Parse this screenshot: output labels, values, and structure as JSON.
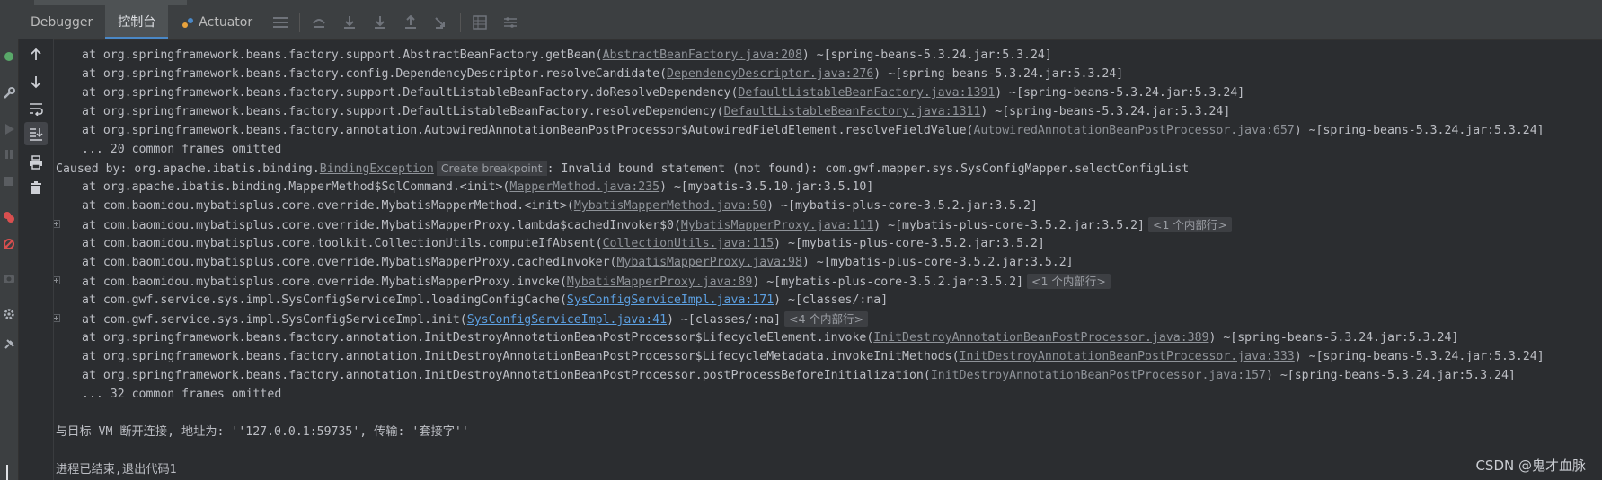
{
  "tabs": [
    {
      "label": "Debugger",
      "active": false
    },
    {
      "label": "控制台",
      "active": true
    },
    {
      "label": "Actuator",
      "active": false
    }
  ],
  "toolbar_icons": [
    "menu-icon",
    "step-over-icon",
    "step-into-icon",
    "force-step-into-icon",
    "step-out-icon",
    "run-to-cursor-icon",
    "evaluate-icon",
    "trace-icon"
  ],
  "sidebar_icons": [
    "up-arrow-icon",
    "down-arrow-icon",
    "soft-wrap-icon",
    "scroll-to-end-icon",
    "print-icon",
    "trash-icon"
  ],
  "console": {
    "lines": [
      {
        "indent": true,
        "pre": "at org.springframework.beans.factory.support.AbstractBeanFactory.getBean(",
        "link": "AbstractBeanFactory.java:208",
        "post": ") ~[spring-beans-5.3.24.jar:5.3.24]"
      },
      {
        "indent": true,
        "pre": "at org.springframework.beans.factory.config.DependencyDescriptor.resolveCandidate(",
        "link": "DependencyDescriptor.java:276",
        "post": ") ~[spring-beans-5.3.24.jar:5.3.24]"
      },
      {
        "indent": true,
        "pre": "at org.springframework.beans.factory.support.DefaultListableBeanFactory.doResolveDependency(",
        "link": "DefaultListableBeanFactory.java:1391",
        "post": ") ~[spring-beans-5.3.24.jar:5.3.24]"
      },
      {
        "indent": true,
        "pre": "at org.springframework.beans.factory.support.DefaultListableBeanFactory.resolveDependency(",
        "link": "DefaultListableBeanFactory.java:1311",
        "post": ") ~[spring-beans-5.3.24.jar:5.3.24]"
      },
      {
        "indent": true,
        "pre": "at org.springframework.beans.factory.annotation.AutowiredAnnotationBeanPostProcessor$AutowiredFieldElement.resolveFieldValue(",
        "link": "AutowiredAnnotationBeanPostProcessor.java:657",
        "post": ") ~[spring-beans-5.3.24.jar:5.3.24]"
      },
      {
        "indent": true,
        "pre": "... 20 common frames omitted"
      },
      {
        "indent": false,
        "pre": "Caused by: org.apache.ibatis.binding.",
        "link": "BindingException",
        "badge": "Create breakpoint",
        "post": ": Invalid bound statement (not found): com.gwf.mapper.sys.SysConfigMapper.selectConfigList"
      },
      {
        "indent": true,
        "pre": "at org.apache.ibatis.binding.MapperMethod$SqlCommand.<init>(",
        "link": "MapperMethod.java:235",
        "post": ") ~[mybatis-3.5.10.jar:3.5.10]"
      },
      {
        "indent": true,
        "pre": "at com.baomidou.mybatisplus.core.override.MybatisMapperMethod.<init>(",
        "link": "MybatisMapperMethod.java:50",
        "post": ") ~[mybatis-plus-core-3.5.2.jar:3.5.2]"
      },
      {
        "indent": true,
        "gutter": true,
        "pre": "at com.baomidou.mybatisplus.core.override.MybatisMapperProxy.lambda$cachedInvoker$0(",
        "link": "MybatisMapperProxy.java:111",
        "post": ") ~[mybatis-plus-core-3.5.2.jar:3.5.2]",
        "folded": "<1 个内部行>"
      },
      {
        "indent": true,
        "pre": "at com.baomidou.mybatisplus.core.toolkit.CollectionUtils.computeIfAbsent(",
        "link": "CollectionUtils.java:115",
        "post": ") ~[mybatis-plus-core-3.5.2.jar:3.5.2]"
      },
      {
        "indent": true,
        "pre": "at com.baomidou.mybatisplus.core.override.MybatisMapperProxy.cachedInvoker(",
        "link": "MybatisMapperProxy.java:98",
        "post": ") ~[mybatis-plus-core-3.5.2.jar:3.5.2]"
      },
      {
        "indent": true,
        "gutter": true,
        "pre": "at com.baomidou.mybatisplus.core.override.MybatisMapperProxy.invoke(",
        "link": "MybatisMapperProxy.java:89",
        "post": ") ~[mybatis-plus-core-3.5.2.jar:3.5.2]",
        "folded": "<1 个内部行>"
      },
      {
        "indent": true,
        "pre": "at com.gwf.service.sys.impl.SysConfigServiceImpl.loadingConfigCache(",
        "link": "SysConfigServiceImpl.java:171",
        "linkBlue": true,
        "post": ") ~[classes/:na]"
      },
      {
        "indent": true,
        "gutter": true,
        "pre": "at com.gwf.service.sys.impl.SysConfigServiceImpl.init(",
        "link": "SysConfigServiceImpl.java:41",
        "linkBlue": true,
        "post": ") ~[classes/:na]",
        "folded": "<4 个内部行>"
      },
      {
        "indent": true,
        "pre": "at org.springframework.beans.factory.annotation.InitDestroyAnnotationBeanPostProcessor$LifecycleElement.invoke(",
        "link": "InitDestroyAnnotationBeanPostProcessor.java:389",
        "post": ") ~[spring-beans-5.3.24.jar:5.3.24]"
      },
      {
        "indent": true,
        "pre": "at org.springframework.beans.factory.annotation.InitDestroyAnnotationBeanPostProcessor$LifecycleMetadata.invokeInitMethods(",
        "link": "InitDestroyAnnotationBeanPostProcessor.java:333",
        "post": ") ~[spring-beans-5.3.24.jar:5.3.24]"
      },
      {
        "indent": true,
        "pre": "at org.springframework.beans.factory.annotation.InitDestroyAnnotationBeanPostProcessor.postProcessBeforeInitialization(",
        "link": "InitDestroyAnnotationBeanPostProcessor.java:157",
        "post": ") ~[spring-beans-5.3.24.jar:5.3.24]"
      },
      {
        "indent": true,
        "pre": "... 32 common frames omitted"
      },
      {
        "indent": false,
        "pre": ""
      },
      {
        "indent": false,
        "pre": "与目标 VM 断开连接, 地址为: ''127.0.0.1:59735', 传输: '套接字''"
      },
      {
        "indent": false,
        "pre": ""
      },
      {
        "indent": false,
        "pre": "进程已结束,退出代码1"
      }
    ]
  },
  "watermark": "CSDN @鬼才血脉",
  "colors": {
    "background": "#2b2d30",
    "text": "#bcbec4",
    "link": "#8f9399",
    "link_blue": "#5c9fe0",
    "accent": "#4a88c7"
  }
}
